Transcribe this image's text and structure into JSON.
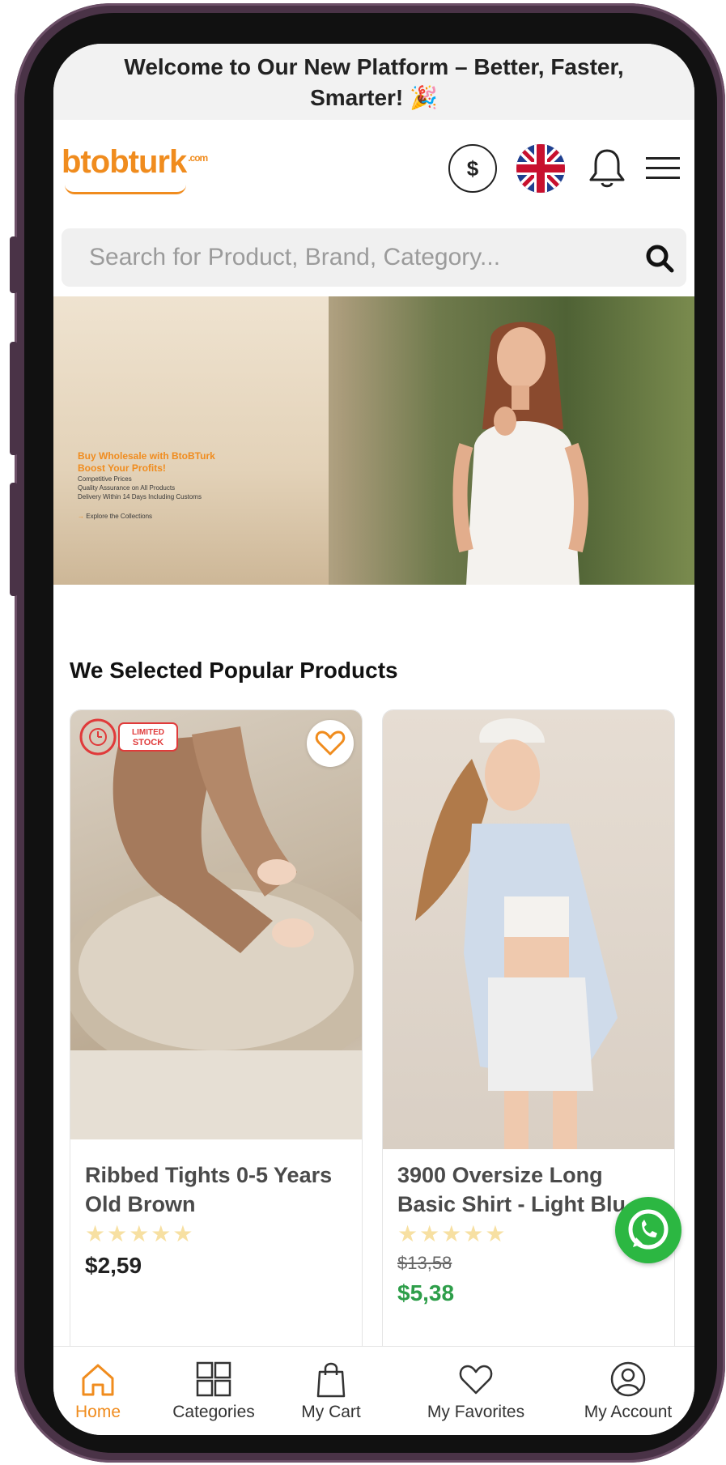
{
  "announcement": {
    "line1": "Welcome to Our New Platform – Better, Faster,",
    "line2": "Smarter!",
    "emoji": "🎉"
  },
  "header": {
    "logo_text": "btobturk",
    "logo_suffix": ".com",
    "currency_symbol": "$",
    "brand_color": "#f08c1e"
  },
  "search": {
    "placeholder": "Search for Product, Brand, Category..."
  },
  "hero": {
    "headline_1": "Buy Wholesale with BtoBTurk",
    "headline_2": "Boost Your Profits!",
    "bullets": [
      "Competitive Prices",
      "Quality Assurance on All Products",
      "Delivery Within 14 Days Including Customs"
    ],
    "cta": "Explore the Collections"
  },
  "section": {
    "title": "We Selected Popular Products"
  },
  "products": [
    {
      "badge_line1": "LIMITED",
      "badge_line2": "STOCK",
      "name_line1": "Ribbed Tights 0-5 Years",
      "name_line2": "Old Brown",
      "stars": "★★★★★",
      "price": "$2,59"
    },
    {
      "name_line1": "3900 Oversize Long",
      "name_line2": "Basic Shirt - Light Blu",
      "stars": "★★★★★",
      "old_price": "$13,58",
      "sale_price": "$5,38"
    }
  ],
  "nav": {
    "home": "Home",
    "categories": "Categories",
    "cart": "My Cart",
    "favorites": "My Favorites",
    "account": "My Account"
  },
  "colors": {
    "accent": "#f08c1e",
    "sale": "#2e9e4a",
    "whatsapp": "#2cb742",
    "frame": "#4a3347"
  }
}
